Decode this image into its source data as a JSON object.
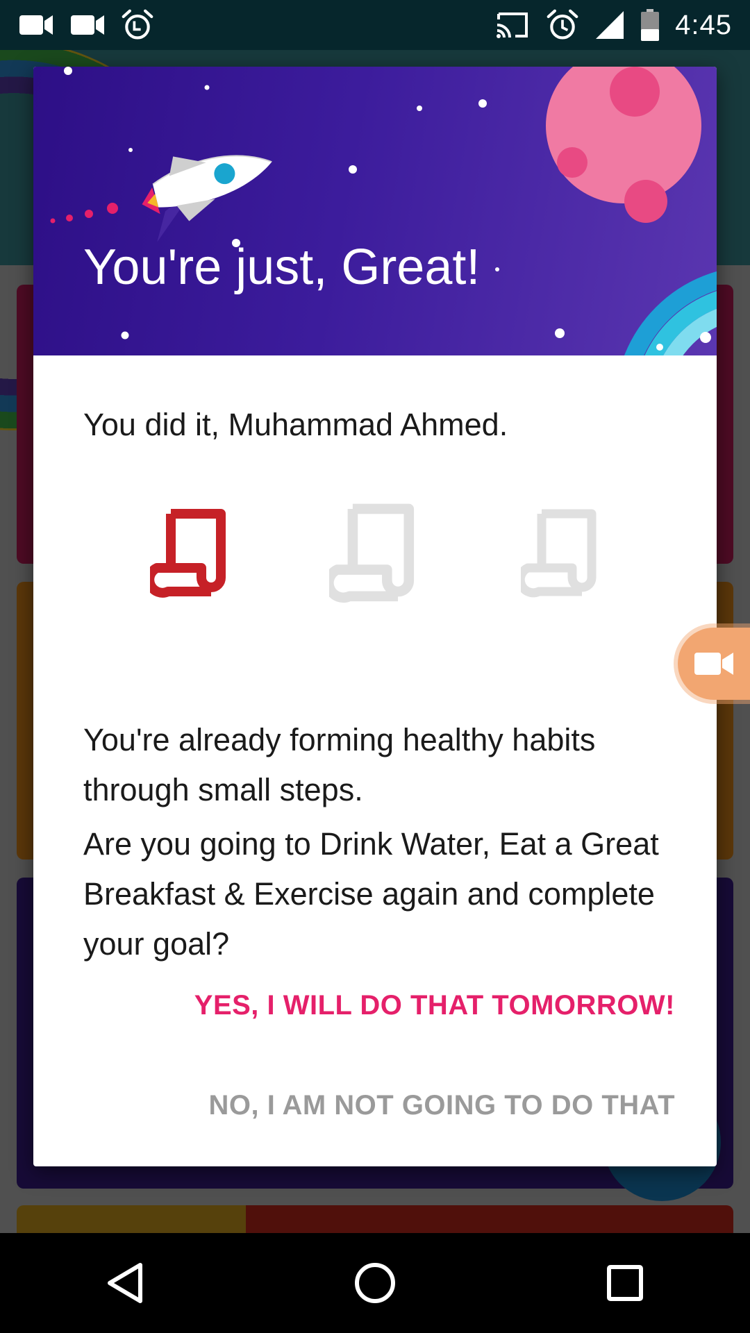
{
  "status_bar": {
    "time": "4:45",
    "left_icons": [
      "video-camera-icon",
      "video-camera-icon",
      "alarm-clock-icon"
    ],
    "right_icons": [
      "cast-icon",
      "alarm-icon",
      "cellular-signal-icon",
      "battery-icon"
    ]
  },
  "dialog": {
    "title": "You're just, Great!",
    "greeting": "You did it, Muhammad Ahmed.",
    "progress": {
      "completed": 1,
      "total": 3
    },
    "message_1": "You're already forming healthy habits through small steps.",
    "message_2": "Are you going to Drink Water, Eat a Great Breakfast & Exercise again and complete your goal?",
    "yes_label": "YES, I WILL DO THAT TOMORROW!",
    "no_label": "NO, I AM NOT GOING TO DO THAT"
  },
  "colors": {
    "accent": "#e5206a",
    "scroll_active": "#c62127",
    "scroll_inactive": "#e0e0e0",
    "header": "#3c1c9c",
    "planet": "#f07aa3"
  },
  "nav_bar": {
    "icons": [
      "back-icon",
      "home-icon",
      "recents-icon"
    ]
  }
}
